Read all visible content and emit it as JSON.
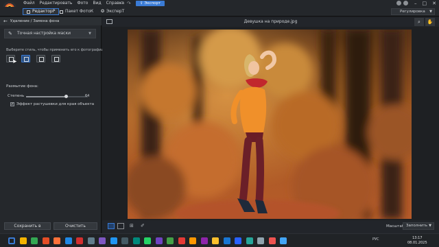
{
  "menu": {
    "items": [
      "Файл",
      "Редактировать",
      "Фото",
      "Вид",
      "Справка"
    ],
    "export_label": "Экспорт"
  },
  "tabs": [
    {
      "label": "РедакторР",
      "active": true
    },
    {
      "label": "Пакет ФотоК",
      "active": false
    },
    {
      "label": "ЭксперТ",
      "active": false
    }
  ],
  "mode_select": {
    "value": "Регулировка"
  },
  "left_panel": {
    "header": "Удаление / Замена фона",
    "mask_select": "Точная настройка маски",
    "hint": "Выберите стиль, чтобы применить его к фотографии.",
    "style_buttons": [
      "style-1",
      "style-2",
      "style-3",
      "style-4"
    ],
    "selected_style": 1,
    "blur_label": "Размытие фона:",
    "degree_label": "Степень",
    "degree_value": "64",
    "degree_fraction": 0.64,
    "feather_label": "Эффект растушевки для края объекта",
    "feather_checked": true,
    "save_button": "Сохранить в",
    "clear_button": "Очистить"
  },
  "workspace": {
    "file_title": "Девушка на природе.jpg",
    "zoom_label": "Масштаб",
    "zoom_value": "Заполнить"
  },
  "taskbar": {
    "tray_lang": "РУС",
    "time": "13:17",
    "date": "08.01.2025",
    "icon_colors": [
      "#3a7bd5",
      "#f4b400",
      "#34a853",
      "#e44d26",
      "#ff7139",
      "#1e88e5",
      "#d32f2f",
      "#607d8b",
      "#7e57c2",
      "#2196f3",
      "#455a64",
      "#00897b",
      "#25d366",
      "#6f42c1",
      "#43a047",
      "#e53935",
      "#ff9800",
      "#8e24aa",
      "#fbc02d",
      "#1976d2",
      "#2962ff",
      "#26a69a",
      "#90a4ae",
      "#ef5350",
      "#42a5f5"
    ]
  },
  "colors": {
    "accent": "#3a7bd5",
    "background": "#1b1d20",
    "panel": "#25282c"
  }
}
